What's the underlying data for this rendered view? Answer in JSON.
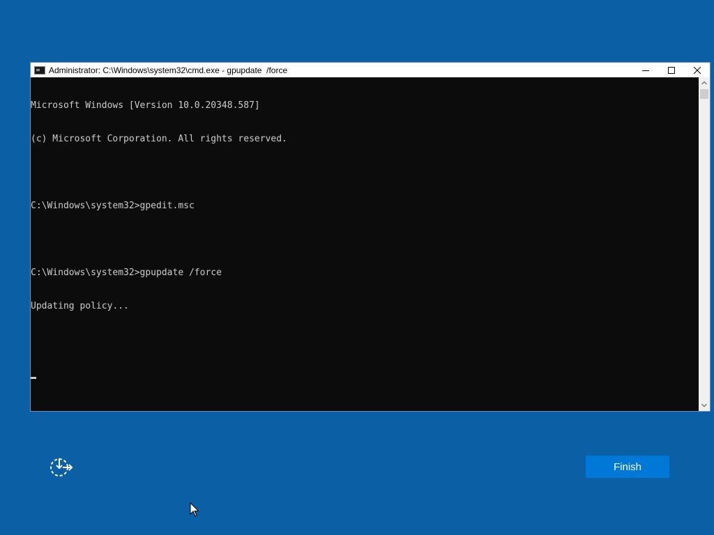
{
  "window": {
    "title": "Administrator: C:\\Windows\\system32\\cmd.exe - gpupdate  /force",
    "icon": "console-icon",
    "controls": {
      "minimize": "minimize-icon",
      "maximize": "maximize-icon",
      "close": "close-icon"
    }
  },
  "console": {
    "lines": [
      "Microsoft Windows [Version 10.0.20348.587]",
      "(c) Microsoft Corporation. All rights reserved.",
      "",
      "C:\\Windows\\system32>gpedit.msc",
      "",
      "C:\\Windows\\system32>gpupdate /force",
      "Updating policy...",
      "",
      ""
    ],
    "text_color": "#cccccc",
    "background_color": "#0c0c0c"
  },
  "oobe": {
    "accessibility_icon": "ease-of-access-icon",
    "finish_label": "Finish",
    "accent_color": "#0078d7",
    "background_color": "#0b5fa5"
  }
}
